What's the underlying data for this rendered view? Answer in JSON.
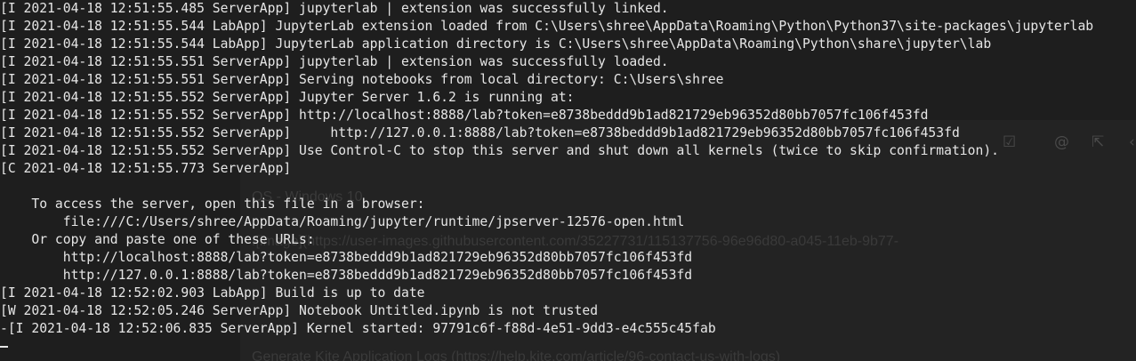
{
  "terminal": {
    "lines": [
      "[I 2021-04-18 12:51:55.485 ServerApp] jupyterlab | extension was successfully linked.",
      "[I 2021-04-18 12:51:55.544 LabApp] JupyterLab extension loaded from C:\\Users\\shree\\AppData\\Roaming\\Python\\Python37\\site-packages\\jupyterlab",
      "[I 2021-04-18 12:51:55.544 LabApp] JupyterLab application directory is C:\\Users\\shree\\AppData\\Roaming\\Python\\share\\jupyter\\lab",
      "[I 2021-04-18 12:51:55.551 ServerApp] jupyterlab | extension was successfully loaded.",
      "[I 2021-04-18 12:51:55.551 ServerApp] Serving notebooks from local directory: C:\\Users\\shree",
      "[I 2021-04-18 12:51:55.552 ServerApp] Jupyter Server 1.6.2 is running at:",
      "[I 2021-04-18 12:51:55.552 ServerApp] http://localhost:8888/lab?token=e8738beddd9b1ad821729eb96352d80bb7057fc106f453fd",
      "[I 2021-04-18 12:51:55.552 ServerApp]     http://127.0.0.1:8888/lab?token=e8738beddd9b1ad821729eb96352d80bb7057fc106f453fd",
      "[I 2021-04-18 12:51:55.552 ServerApp] Use Control-C to stop this server and shut down all kernels (twice to skip confirmation).",
      "[C 2021-04-18 12:51:55.773 ServerApp]",
      "",
      "    To access the server, open this file in a browser:",
      "        file:///C:/Users/shree/AppData/Roaming/jupyter/runtime/jpserver-12576-open.html",
      "    Or copy and paste one of these URLs:",
      "        http://localhost:8888/lab?token=e8738beddd9b1ad821729eb96352d80bb7057fc106f453fd",
      "        http://127.0.0.1:8888/lab?token=e8738beddd9b1ad821729eb96352d80bb7057fc106f453fd",
      "[I 2021-04-18 12:52:02.903 LabApp] Build is up to date",
      "[W 2021-04-18 12:52:05.246 ServerApp] Notebook Untitled.ipynb is not trusted",
      "-[I 2021-04-18 12:52:06.835 ServerApp] Kernel started: 97791c6f-f88d-4e51-9dd3-e4c555c45fab"
    ]
  },
  "background_window": {
    "os_line": "OS - Windows 10",
    "image_link_line": "![image](https://user-images.githubusercontent.com/35227731/115137756-96e96d80-a045-11eb-9b77-",
    "logs_line": "Generate Kite Application Logs (https://help.kite.com/article/96-contact-us-with-logs)"
  },
  "colors": {
    "terminal_bg": "#1e1e1e",
    "terminal_fg": "#e6e6e6",
    "ghost_fg": "#3a3a3a"
  }
}
